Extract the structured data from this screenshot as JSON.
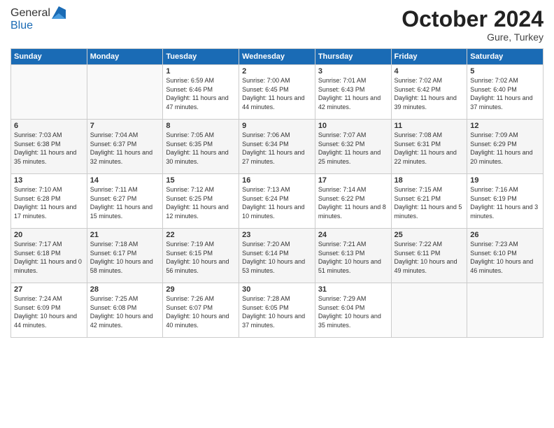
{
  "logo": {
    "line1": "General",
    "line2": "Blue"
  },
  "header": {
    "month": "October 2024",
    "location": "Gure, Turkey"
  },
  "weekdays": [
    "Sunday",
    "Monday",
    "Tuesday",
    "Wednesday",
    "Thursday",
    "Friday",
    "Saturday"
  ],
  "weeks": [
    [
      {
        "day": "",
        "info": ""
      },
      {
        "day": "",
        "info": ""
      },
      {
        "day": "1",
        "info": "Sunrise: 6:59 AM\nSunset: 6:46 PM\nDaylight: 11 hours and 47 minutes."
      },
      {
        "day": "2",
        "info": "Sunrise: 7:00 AM\nSunset: 6:45 PM\nDaylight: 11 hours and 44 minutes."
      },
      {
        "day": "3",
        "info": "Sunrise: 7:01 AM\nSunset: 6:43 PM\nDaylight: 11 hours and 42 minutes."
      },
      {
        "day": "4",
        "info": "Sunrise: 7:02 AM\nSunset: 6:42 PM\nDaylight: 11 hours and 39 minutes."
      },
      {
        "day": "5",
        "info": "Sunrise: 7:02 AM\nSunset: 6:40 PM\nDaylight: 11 hours and 37 minutes."
      }
    ],
    [
      {
        "day": "6",
        "info": "Sunrise: 7:03 AM\nSunset: 6:38 PM\nDaylight: 11 hours and 35 minutes."
      },
      {
        "day": "7",
        "info": "Sunrise: 7:04 AM\nSunset: 6:37 PM\nDaylight: 11 hours and 32 minutes."
      },
      {
        "day": "8",
        "info": "Sunrise: 7:05 AM\nSunset: 6:35 PM\nDaylight: 11 hours and 30 minutes."
      },
      {
        "day": "9",
        "info": "Sunrise: 7:06 AM\nSunset: 6:34 PM\nDaylight: 11 hours and 27 minutes."
      },
      {
        "day": "10",
        "info": "Sunrise: 7:07 AM\nSunset: 6:32 PM\nDaylight: 11 hours and 25 minutes."
      },
      {
        "day": "11",
        "info": "Sunrise: 7:08 AM\nSunset: 6:31 PM\nDaylight: 11 hours and 22 minutes."
      },
      {
        "day": "12",
        "info": "Sunrise: 7:09 AM\nSunset: 6:29 PM\nDaylight: 11 hours and 20 minutes."
      }
    ],
    [
      {
        "day": "13",
        "info": "Sunrise: 7:10 AM\nSunset: 6:28 PM\nDaylight: 11 hours and 17 minutes."
      },
      {
        "day": "14",
        "info": "Sunrise: 7:11 AM\nSunset: 6:27 PM\nDaylight: 11 hours and 15 minutes."
      },
      {
        "day": "15",
        "info": "Sunrise: 7:12 AM\nSunset: 6:25 PM\nDaylight: 11 hours and 12 minutes."
      },
      {
        "day": "16",
        "info": "Sunrise: 7:13 AM\nSunset: 6:24 PM\nDaylight: 11 hours and 10 minutes."
      },
      {
        "day": "17",
        "info": "Sunrise: 7:14 AM\nSunset: 6:22 PM\nDaylight: 11 hours and 8 minutes."
      },
      {
        "day": "18",
        "info": "Sunrise: 7:15 AM\nSunset: 6:21 PM\nDaylight: 11 hours and 5 minutes."
      },
      {
        "day": "19",
        "info": "Sunrise: 7:16 AM\nSunset: 6:19 PM\nDaylight: 11 hours and 3 minutes."
      }
    ],
    [
      {
        "day": "20",
        "info": "Sunrise: 7:17 AM\nSunset: 6:18 PM\nDaylight: 11 hours and 0 minutes."
      },
      {
        "day": "21",
        "info": "Sunrise: 7:18 AM\nSunset: 6:17 PM\nDaylight: 10 hours and 58 minutes."
      },
      {
        "day": "22",
        "info": "Sunrise: 7:19 AM\nSunset: 6:15 PM\nDaylight: 10 hours and 56 minutes."
      },
      {
        "day": "23",
        "info": "Sunrise: 7:20 AM\nSunset: 6:14 PM\nDaylight: 10 hours and 53 minutes."
      },
      {
        "day": "24",
        "info": "Sunrise: 7:21 AM\nSunset: 6:13 PM\nDaylight: 10 hours and 51 minutes."
      },
      {
        "day": "25",
        "info": "Sunrise: 7:22 AM\nSunset: 6:11 PM\nDaylight: 10 hours and 49 minutes."
      },
      {
        "day": "26",
        "info": "Sunrise: 7:23 AM\nSunset: 6:10 PM\nDaylight: 10 hours and 46 minutes."
      }
    ],
    [
      {
        "day": "27",
        "info": "Sunrise: 7:24 AM\nSunset: 6:09 PM\nDaylight: 10 hours and 44 minutes."
      },
      {
        "day": "28",
        "info": "Sunrise: 7:25 AM\nSunset: 6:08 PM\nDaylight: 10 hours and 42 minutes."
      },
      {
        "day": "29",
        "info": "Sunrise: 7:26 AM\nSunset: 6:07 PM\nDaylight: 10 hours and 40 minutes."
      },
      {
        "day": "30",
        "info": "Sunrise: 7:28 AM\nSunset: 6:05 PM\nDaylight: 10 hours and 37 minutes."
      },
      {
        "day": "31",
        "info": "Sunrise: 7:29 AM\nSunset: 6:04 PM\nDaylight: 10 hours and 35 minutes."
      },
      {
        "day": "",
        "info": ""
      },
      {
        "day": "",
        "info": ""
      }
    ]
  ]
}
